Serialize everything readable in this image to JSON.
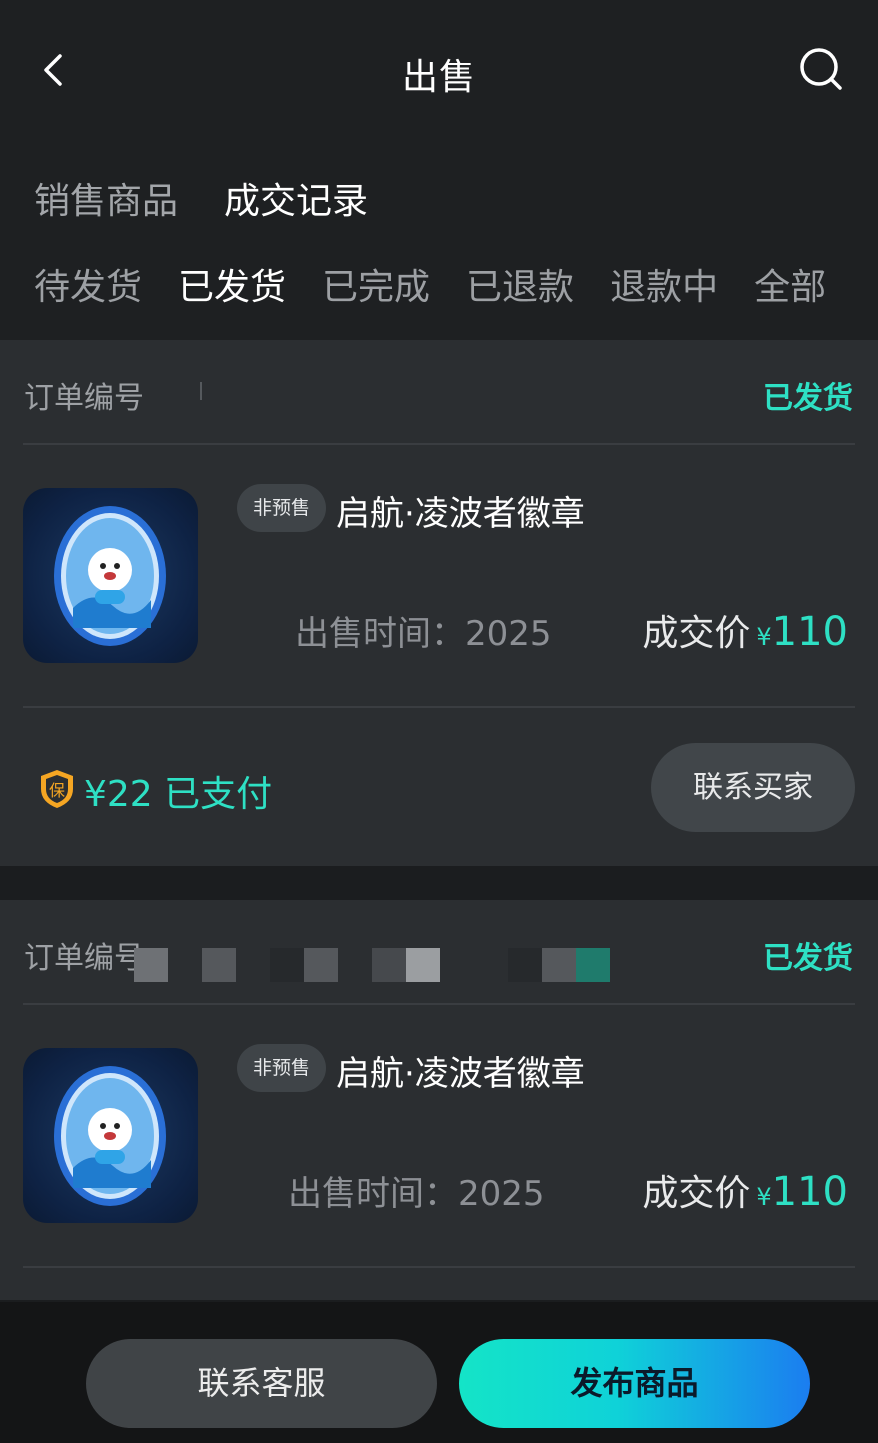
{
  "header": {
    "title": "出售",
    "back_icon": "chevron-left-icon",
    "search_icon": "search-icon"
  },
  "tabs_primary": [
    {
      "label": "销售商品",
      "active": false
    },
    {
      "label": "成交记录",
      "active": true
    }
  ],
  "tabs_status": [
    {
      "label": "待发货",
      "active": false
    },
    {
      "label": "已发货",
      "active": true
    },
    {
      "label": "已完成",
      "active": false
    },
    {
      "label": "已退款",
      "active": false
    },
    {
      "label": "退款中",
      "active": false
    },
    {
      "label": "全部",
      "active": false
    }
  ],
  "orders": [
    {
      "order_label": "订单编号",
      "status": "已发货",
      "tag": "非预售",
      "product_name": "启航·凌波者徽章",
      "sell_time": "出售时间：2025",
      "price_label": "成交价",
      "currency": "¥",
      "price": "110",
      "deposit": "¥22 已支付",
      "deposit_icon": "shield-bao-icon",
      "contact_label": "联系买家"
    },
    {
      "order_label": "订单编号：",
      "status": "已发货",
      "tag": "非预售",
      "product_name": "启航·凌波者徽章",
      "sell_time": "出售时间：2025",
      "price_label": "成交价",
      "currency": "¥",
      "price": "110"
    }
  ],
  "bottom": {
    "service_label": "联系客服",
    "publish_label": "发布商品"
  },
  "colors": {
    "accent": "#2ee0c4",
    "background": "#1b1d1f",
    "card": "#2b2e31"
  }
}
